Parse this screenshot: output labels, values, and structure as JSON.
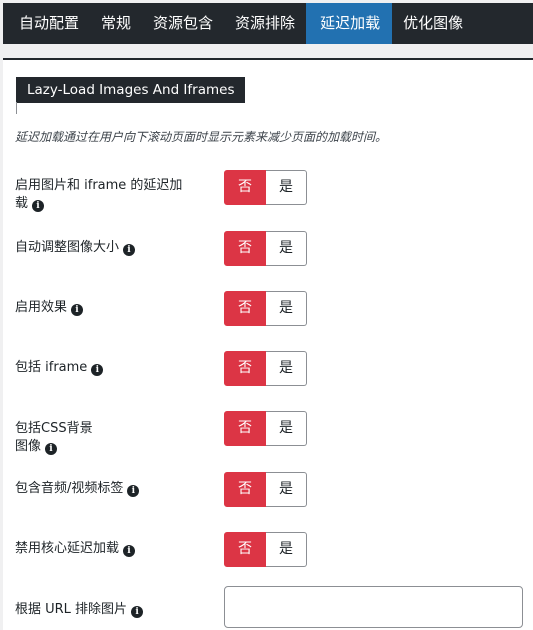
{
  "tabs": [
    {
      "label": "自动配置",
      "active": false
    },
    {
      "label": "常规",
      "active": false
    },
    {
      "label": "资源包含",
      "active": false
    },
    {
      "label": "资源排除",
      "active": false
    },
    {
      "label": "延迟加载",
      "active": true
    },
    {
      "label": "优化图像",
      "active": false
    }
  ],
  "section": {
    "legend": "Lazy-Load Images And Iframes",
    "description": "延迟加载通过在用户向下滚动页面时显示元素来减少页面的加载时间。"
  },
  "settings": [
    {
      "label_line1": "启用图片和 iframe 的延迟加",
      "label_line2": "载",
      "value": "否",
      "off_label": "否",
      "on_label": "是"
    },
    {
      "label": "自动调整图像大小",
      "value": "否",
      "off_label": "否",
      "on_label": "是"
    },
    {
      "label": "启用效果",
      "value": "否",
      "off_label": "否",
      "on_label": "是"
    },
    {
      "label": "包括 iframe",
      "value": "否",
      "off_label": "否",
      "on_label": "是"
    },
    {
      "label_line1": "包括CSS背景",
      "label_line2": "图像",
      "value": "否",
      "off_label": "否",
      "on_label": "是"
    },
    {
      "label": "包含音频/视频标签",
      "value": "否",
      "off_label": "否",
      "on_label": "是"
    },
    {
      "label": "禁用核心延迟加载",
      "value": "否",
      "off_label": "否",
      "on_label": "是"
    }
  ],
  "exclude_images": {
    "label": "根据 URL 排除图片",
    "value": "",
    "placeholder": ""
  },
  "icons": {
    "info": "info-circle-icon"
  },
  "colors": {
    "tab_bar": "#23282d",
    "tab_active": "#2271b1",
    "toggle_off": "#dc3545",
    "panel": "#ffffff",
    "page": "#f0f0f1"
  }
}
